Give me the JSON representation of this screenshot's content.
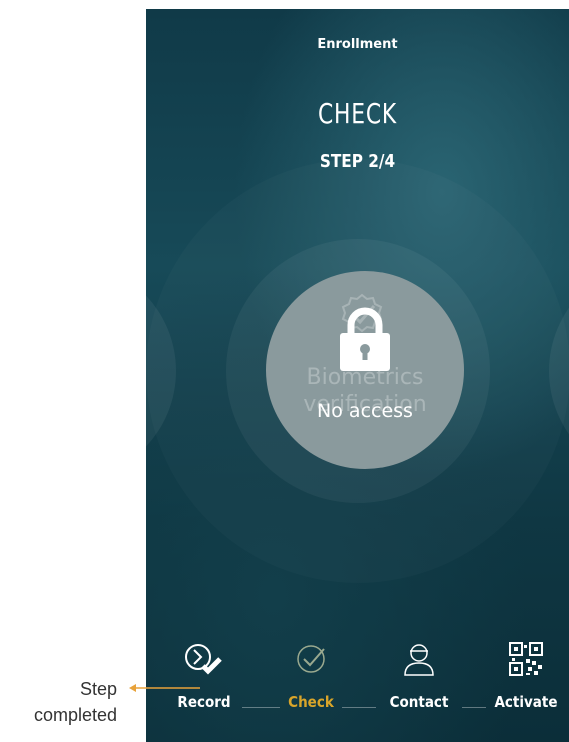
{
  "header": {
    "screen_title": "Enrollment",
    "step_name": "CHECK",
    "step_count": "STEP 2/4"
  },
  "center": {
    "background_text": "Biometrics verification",
    "status_text": "No access",
    "status_icon": "lock-icon",
    "background_icon": "check-badge-icon"
  },
  "steps": [
    {
      "label": "Record",
      "icon": "record-arrow-icon",
      "state": "completed"
    },
    {
      "label": "Check",
      "icon": "check-badge-icon",
      "state": "current"
    },
    {
      "label": "Contact",
      "icon": "person-icon",
      "state": "pending"
    },
    {
      "label": "Activate",
      "icon": "qr-code-icon",
      "state": "pending"
    }
  ],
  "annotation": {
    "line1": "Step",
    "line2": "completed"
  },
  "colors": {
    "active_step": "#d9a52a",
    "background": "#103a48",
    "annotation_arrow": "#e8a23a"
  }
}
